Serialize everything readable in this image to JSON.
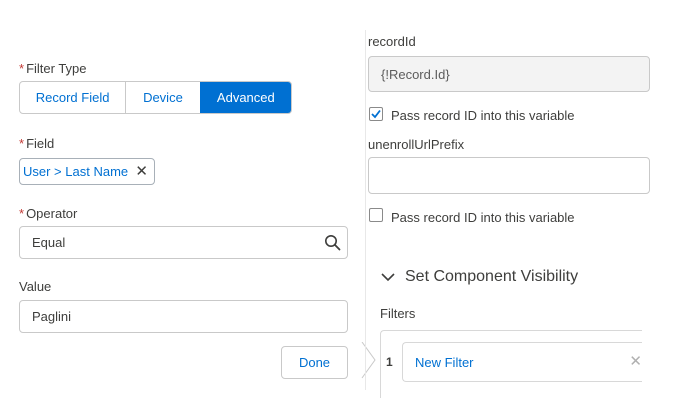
{
  "filter_type": {
    "label": "Filter Type",
    "options": [
      "Record Field",
      "Device",
      "Advanced"
    ],
    "selected": "Advanced"
  },
  "field": {
    "label": "Field",
    "value": "User > Last Name"
  },
  "operator": {
    "label": "Operator",
    "value": "Equal"
  },
  "value_field": {
    "label": "Value",
    "value": "Paglini"
  },
  "done_button": "Done",
  "record_id": {
    "label": "recordId",
    "value": "{!Record.Id}",
    "checkbox_label": "Pass record ID into this variable",
    "checked": true
  },
  "unenroll_prefix": {
    "label": "unenrollUrlPrefix",
    "value": "",
    "checkbox_label": "Pass record ID into this variable",
    "checked": false
  },
  "visibility": {
    "title": "Set Component Visibility",
    "filters_label": "Filters",
    "rows": [
      {
        "index": "1",
        "name": "New Filter"
      }
    ]
  },
  "colors": {
    "brand": "#0070d2",
    "required": "#c23934"
  }
}
